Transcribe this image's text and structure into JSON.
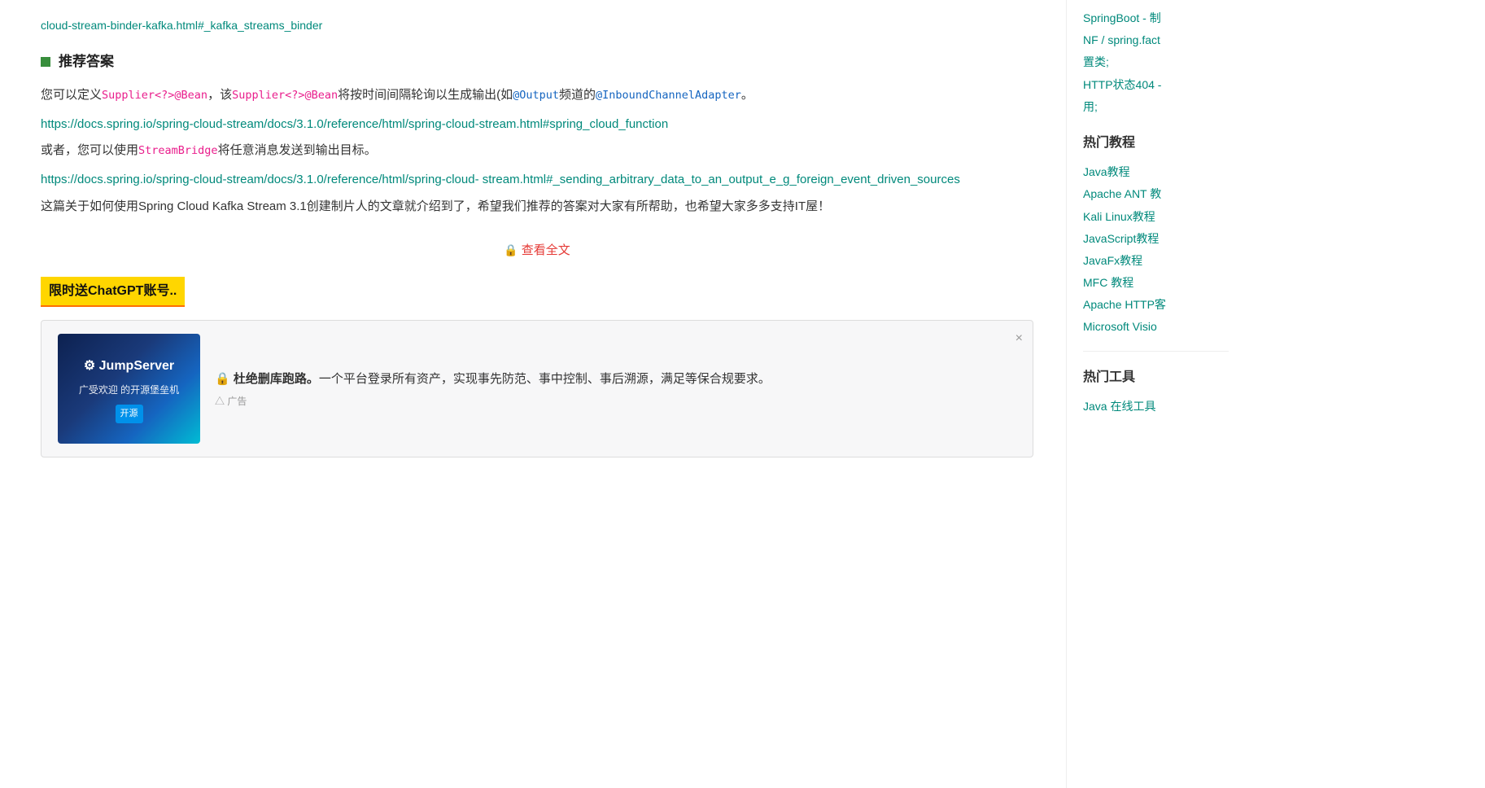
{
  "topLink": {
    "text": "cloud-stream-binder-kafka.html#_kafka_streams_binder",
    "href": "#"
  },
  "recommendedAnswer": {
    "label": "推荐答案",
    "para1_prefix": "您可以定义",
    "code1": "Supplier<?>@Bean",
    "para1_mid": "，该",
    "code2": "Supplier<?>@Bean",
    "para1_suffix1": "将按时间间隔轮询以生成输出(如",
    "code3": "@Output",
    "para1_suffix2": "频道的",
    "code4": "@InboundChannelAdapter",
    "para1_end": "。",
    "link1": "https://docs.spring.io/spring-cloud-stream/docs/3.1.0/reference/html/spring-cloud-stream.html#spring_cloud_function",
    "para2_prefix": "或者，您可以使用",
    "code5": "StreamBridge",
    "para2_suffix": "将任意消息发送到输出目标。",
    "link2_line1": "https://docs.spring.io/spring-cloud-stream/docs/3.1.0/reference/html/spring-cloud-",
    "link2_line2": "stream.html#_sending_arbitrary_data_to_an_output_e_g_foreign_event_driven_sources",
    "para3": "这篇关于如何使用Spring Cloud Kafka Stream 3.1创建制片人的文章就介绍到了，希望我们推荐的答案对大家有所帮助，也希望大家多多支持IT屋！"
  },
  "viewFull": {
    "icon": "🔒",
    "text": "查看全文"
  },
  "promo": {
    "bannerTitle": "限时送ChatGPT账号..",
    "imgLogo": "⚙ JumpServer",
    "imgSub": "广受欢迎 的开源堡垒机",
    "adText": "🔒 杜绝删库跑路。一个平台登录所有资产，实现事先防范、事中控制、事后溯源，满足等保合规要求。",
    "adLabel": "△ 广告",
    "closeBtn": "×"
  },
  "sidebar": {
    "hotTutorials": {
      "title": "热门教程",
      "links": [
        {
          "text": "Java教程",
          "href": "#"
        },
        {
          "text": "Apache ANT 教程",
          "href": "#"
        },
        {
          "text": "Kali Linux教程",
          "href": "#"
        },
        {
          "text": "JavaScript教程",
          "href": "#"
        },
        {
          "text": "JavaFx教程",
          "href": "#"
        },
        {
          "text": "MFC 教程",
          "href": "#"
        },
        {
          "text": "Apache HTTP客户端教程",
          "href": "#"
        },
        {
          "text": "Microsoft Visio教程",
          "href": "#"
        }
      ]
    },
    "hotTools": {
      "title": "热门工具",
      "links": [
        {
          "text": "Java 在线工具",
          "href": "#"
        }
      ]
    },
    "rightTopLinks": [
      {
        "text": "SpringBoot - 制",
        "href": "#"
      },
      {
        "text": "NF / spring.fact",
        "href": "#"
      },
      {
        "text": "置类;",
        "href": "#"
      },
      {
        "text": "HTTP状态404 -",
        "href": "#"
      },
      {
        "text": "用;",
        "href": "#"
      }
    ]
  }
}
